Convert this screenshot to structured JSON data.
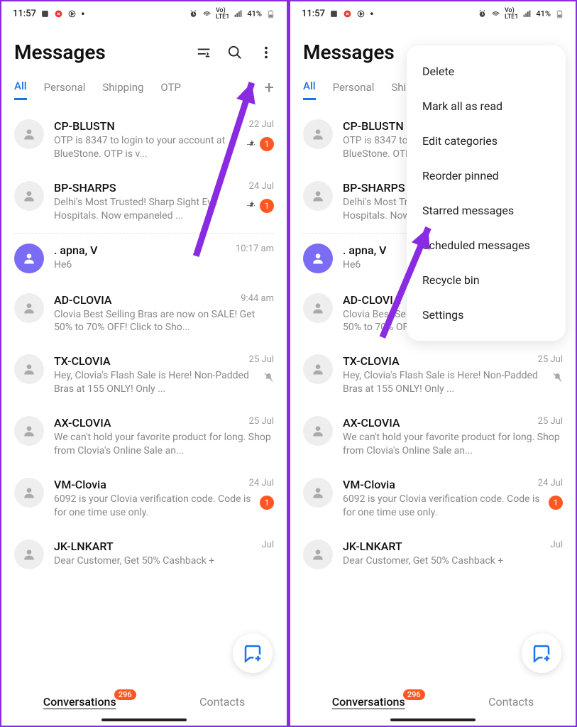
{
  "status": {
    "time": "11:57",
    "battery": "41%",
    "lte": "LTE1",
    "vo": "Vo)"
  },
  "header": {
    "title": "Messages"
  },
  "tabs": [
    "All",
    "Personal",
    "Shipping",
    "OTP"
  ],
  "convs": [
    {
      "name": "CP-BLUSTN",
      "date": "22 Jul",
      "prev": "OTP is 8347 to login to your account at BlueStone. OTP is v...",
      "pin": true,
      "badge": "1"
    },
    {
      "name": "BP-SHARPS",
      "date": "24 Jul",
      "prev": "Delhi's Most Trusted! Sharp Sight Eye Hospitals. Now empaneled ...",
      "pin": true,
      "badge": "1"
    },
    {
      "name": ". apna, V",
      "date": "10:17 am",
      "prev": "He6",
      "purple": true
    },
    {
      "name": "AD-CLOVIA",
      "date": "9:44 am",
      "prev": "Clovia Best Selling Bras are now on SALE! Get 50% to 70% OFF! Click to Sho..."
    },
    {
      "name": "TX-CLOVIA",
      "date": "25 Jul",
      "prev": "Hey, Clovia's Flash Sale is Here! Non-Padded Bras at 155 ONLY! Only ...",
      "mute": true
    },
    {
      "name": "AX-CLOVIA",
      "date": "25 Jul",
      "prev": "We can't hold your favorite product for long. Shop from Clovia's Online Sale an..."
    },
    {
      "name": "VM-Clovia",
      "date": "24 Jul",
      "prev": "6092 is your Clovia verification code. Code is for one time use only.",
      "badge": "1"
    },
    {
      "name": "JK-LNKART",
      "date": "Jul",
      "prev": "Dear Customer, Get 50% Cashback +"
    }
  ],
  "bottom": {
    "t1": "Conversations",
    "t2": "Contacts",
    "count": "296"
  },
  "menu": [
    "Delete",
    "Mark all as read",
    "Edit categories",
    "Reorder pinned",
    "Starred messages",
    "Scheduled messages",
    "Recycle bin",
    "Settings"
  ]
}
